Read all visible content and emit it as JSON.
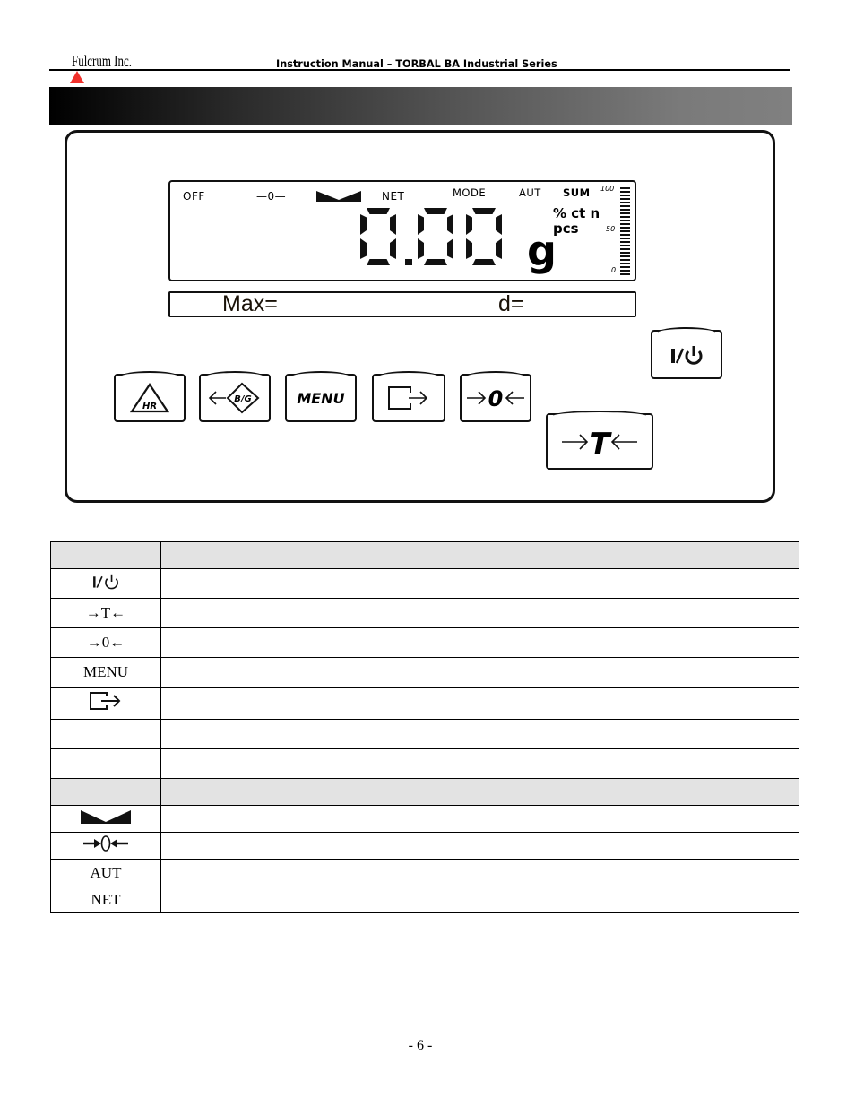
{
  "header": {
    "logo_text": "Fulcrum Inc.",
    "title": "Instruction Manual – TORBAL BA Industrial Series",
    "accent_color": "#f0302b"
  },
  "display": {
    "indicators": {
      "off": "OFF",
      "zero": "—0—",
      "stable": "stable-indicator",
      "net": "NET",
      "mode": "MODE",
      "aut": "AUT",
      "sum": "SUM"
    },
    "reading": "0.00",
    "unit": "g",
    "extra_units_line1": "% ct n",
    "extra_units_line2": "pcs",
    "bargraph_labels": {
      "top": "100",
      "mid": "50",
      "bottom": "0"
    },
    "subdisplay": {
      "max_label": "Max=",
      "d_label": "d="
    }
  },
  "keypad": {
    "keys": [
      {
        "name": "hr-key",
        "icon": "hr-triangle-icon",
        "label": "HR"
      },
      {
        "name": "bg-key",
        "icon": "bg-diamond-icon",
        "label": "B/G"
      },
      {
        "name": "menu-key",
        "icon": "",
        "label": "MENU"
      },
      {
        "name": "print-key",
        "icon": "print-arrow-icon",
        "label": ""
      },
      {
        "name": "zero-key",
        "icon": "zero-arrows-icon",
        "label": "0"
      },
      {
        "name": "tare-key",
        "icon": "tare-arrows-icon",
        "label": "T"
      },
      {
        "name": "power-key",
        "icon": "power-icon",
        "label": "I/⏻"
      }
    ]
  },
  "table": {
    "key_section_header": [
      "",
      ""
    ],
    "key_rows": [
      {
        "symbol": "I/⏻",
        "description": ""
      },
      {
        "symbol": "→T←",
        "description": ""
      },
      {
        "symbol": "→0←",
        "description": ""
      },
      {
        "symbol": "MENU",
        "description": ""
      },
      {
        "symbol": "print-arrow-icon",
        "description": ""
      },
      {
        "symbol": "",
        "description": ""
      },
      {
        "symbol": "",
        "description": ""
      }
    ],
    "indicator_section_header": [
      "",
      ""
    ],
    "indicator_rows": [
      {
        "symbol": "stable-indicator-icon",
        "description": ""
      },
      {
        "symbol": "→0←",
        "description": ""
      },
      {
        "symbol": "AUT",
        "description": ""
      },
      {
        "symbol": "NET",
        "description": ""
      }
    ]
  },
  "footer": {
    "page_number": "- 6 -"
  }
}
